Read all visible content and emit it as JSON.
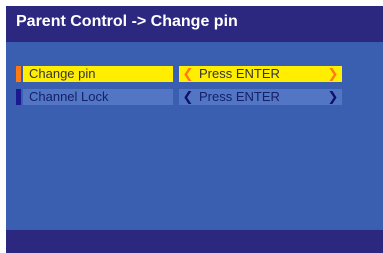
{
  "header": {
    "title": "Parent Control -> Change  pin"
  },
  "menu": {
    "items": [
      {
        "label": "Change pin",
        "value": "Press ENTER",
        "selected": true
      },
      {
        "label": "Channel Lock",
        "value": "Press ENTER",
        "selected": false
      }
    ]
  },
  "icons": {
    "left_arrow": "chevron-left-icon",
    "right_arrow": "chevron-right-icon"
  },
  "colors": {
    "background": "#3a5fb0",
    "header_bar": "#2c2880",
    "highlight": "#ffee00",
    "highlight_marker": "#ff7a10",
    "row_normal": "#5276c4"
  }
}
